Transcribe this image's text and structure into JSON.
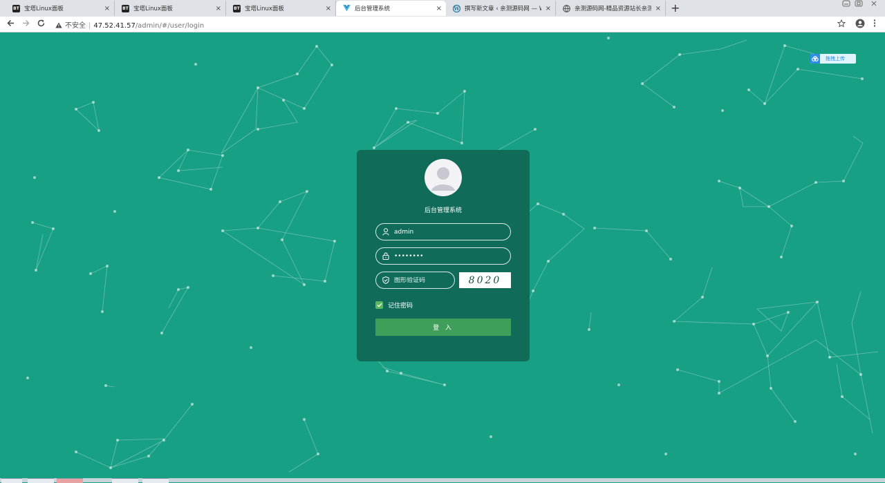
{
  "browser": {
    "tabs": [
      {
        "title": "宝塔Linux面板",
        "favicon": "BT",
        "active": false
      },
      {
        "title": "宝塔Linux面板",
        "favicon": "BT",
        "active": false
      },
      {
        "title": "宝塔Linux面板",
        "favicon": "BT",
        "active": false
      },
      {
        "title": "后台管理系统",
        "favicon": "vue-icon",
        "active": true
      },
      {
        "title": "撰写新文章 ‹ 亲测源码网 — Wo",
        "favicon": "wordpress-icon",
        "active": false
      },
      {
        "title": "亲测源码网-精品资源站长亲测",
        "favicon": "globe-icon",
        "active": false
      }
    ],
    "close_glyph": "×",
    "new_tab_glyph": "+",
    "address": {
      "security_label": "不安全",
      "host": "47.52.41.57",
      "path": "/admin/#/user/login"
    }
  },
  "page": {
    "upload_button": "拖拽上传",
    "login": {
      "title": "后台管理系统",
      "username_value": "admin",
      "password_value": "••••••••",
      "captcha_placeholder": "图形验证码",
      "captcha_image_text": "8020",
      "remember_label": "记住密码",
      "remember_checked": true,
      "submit_label": "登 入"
    }
  },
  "colors": {
    "background": "#18a085",
    "card": "#106c59",
    "button": "#3f9e5a",
    "checkbox": "#5cb85c"
  }
}
